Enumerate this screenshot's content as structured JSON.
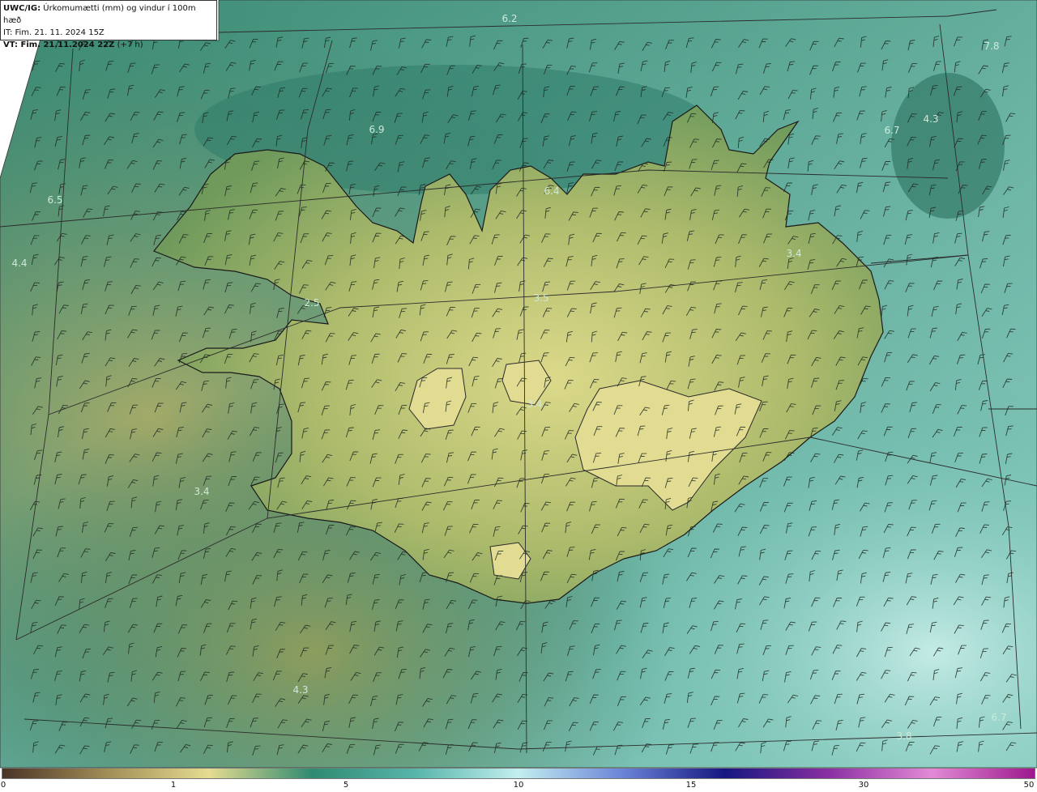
{
  "header": {
    "product_code": "UWC/IG:",
    "title": "Úrkomumætti (mm) og vindur í 100m hæð",
    "initial_time": "IT: Fim. 21. 11. 2024 15Z",
    "valid_time": "VT: Fim. 21.11.2024 22Z",
    "lead_time": "(+7 h)"
  },
  "map_labels": [
    "6.2",
    "7.8",
    "4.3",
    "6.7",
    "6.9",
    "6.4",
    "6.5",
    "4.4",
    "3.4",
    "2.5",
    "3.5",
    "3.4",
    "3.4",
    "4.3",
    "6.7",
    "3.8"
  ],
  "legend": {
    "ticks": [
      "0",
      "1",
      "5",
      "10",
      "15",
      "30",
      "50"
    ],
    "colors": [
      "#4a3526",
      "#a08c55",
      "#e5dc90",
      "#2f8a71",
      "#58b5aa",
      "#c2efef",
      "#6b84d8",
      "#151780",
      "#8a2fa2",
      "#e28ad6",
      "#9d188c"
    ]
  },
  "colors": {
    "sea_low": "#2a7766",
    "land_low": "#8aa85e",
    "land_high": "#d9da8c",
    "coast": "#1a1a1a",
    "grid": "#2b2b2b"
  }
}
